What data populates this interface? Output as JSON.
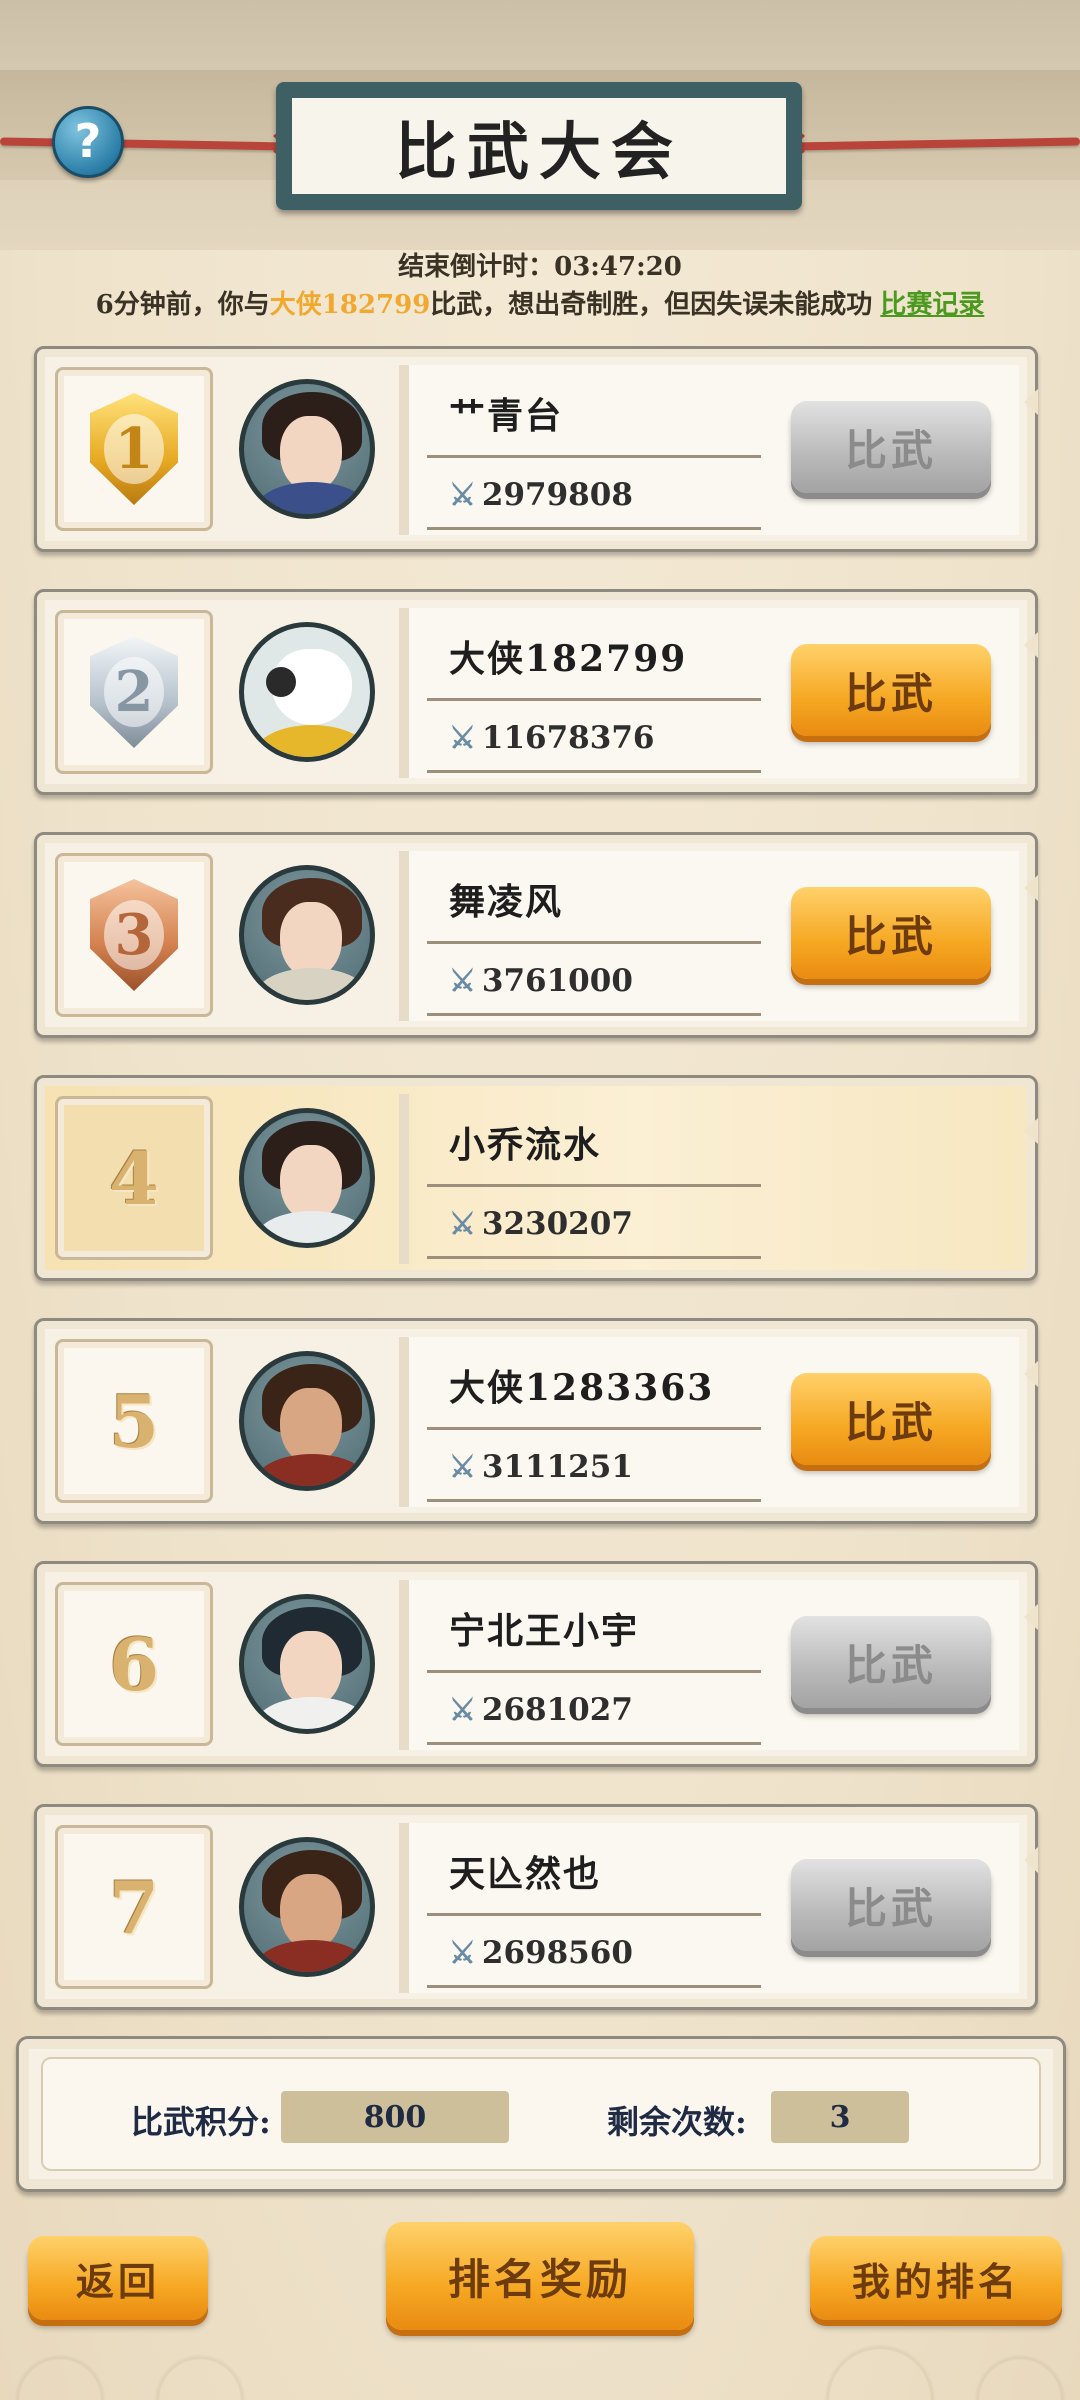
{
  "header": {
    "title": "比武大会",
    "help_symbol": "?"
  },
  "countdown": "结束倒计时：03:47:20",
  "battle_message": {
    "prefix": "6分钟前，你与",
    "opponent": "大侠182799",
    "suffix": "比武，想出奇制胜，但因失误未能成功",
    "record_link": "比赛记录"
  },
  "rankings": [
    {
      "rank": "1",
      "medal": "gold",
      "name": "艹青台",
      "power": "2979808",
      "button": "比武",
      "button_state": "disabled",
      "avatar": "woman-purple-robe"
    },
    {
      "rank": "2",
      "medal": "silver",
      "name": "大侠182799",
      "power": "11678376",
      "button": "比武",
      "button_state": "active",
      "avatar": "panda-yellow-scarf"
    },
    {
      "rank": "3",
      "medal": "bronze",
      "name": "舞凌风",
      "power": "3761000",
      "button": "比武",
      "button_state": "active",
      "avatar": "girl-hair-buns"
    },
    {
      "rank": "4",
      "medal": "none",
      "name": "小乔流水",
      "power": "3230207",
      "button": "",
      "button_state": "self",
      "avatar": "scholar-white-robe"
    },
    {
      "rank": "5",
      "medal": "none",
      "name": "大侠1283363",
      "power": "3111251",
      "button": "比武",
      "button_state": "active",
      "avatar": "warrior-red-headband"
    },
    {
      "rank": "6",
      "medal": "none",
      "name": "宁北王小宇",
      "power": "2681027",
      "button": "比武",
      "button_state": "disabled",
      "avatar": "swordsman-green-headband"
    },
    {
      "rank": "7",
      "medal": "none",
      "name": "天兦然也",
      "power": "2698560",
      "button": "比武",
      "button_state": "disabled",
      "avatar": "warrior-red-headband"
    }
  ],
  "stats": {
    "score_label": "比武积分:",
    "score_value": "800",
    "remaining_label": "剩余次数:",
    "remaining_value": "3"
  },
  "footer": {
    "back": "返回",
    "rewards": "排名奖励",
    "my_rank": "我的排名"
  },
  "colors": {
    "accent_orange": "#f6a823",
    "opponent_highlight": "#f0a92e",
    "record_link": "#4b9a1f",
    "disabled_gray": "#b9b9b9"
  }
}
